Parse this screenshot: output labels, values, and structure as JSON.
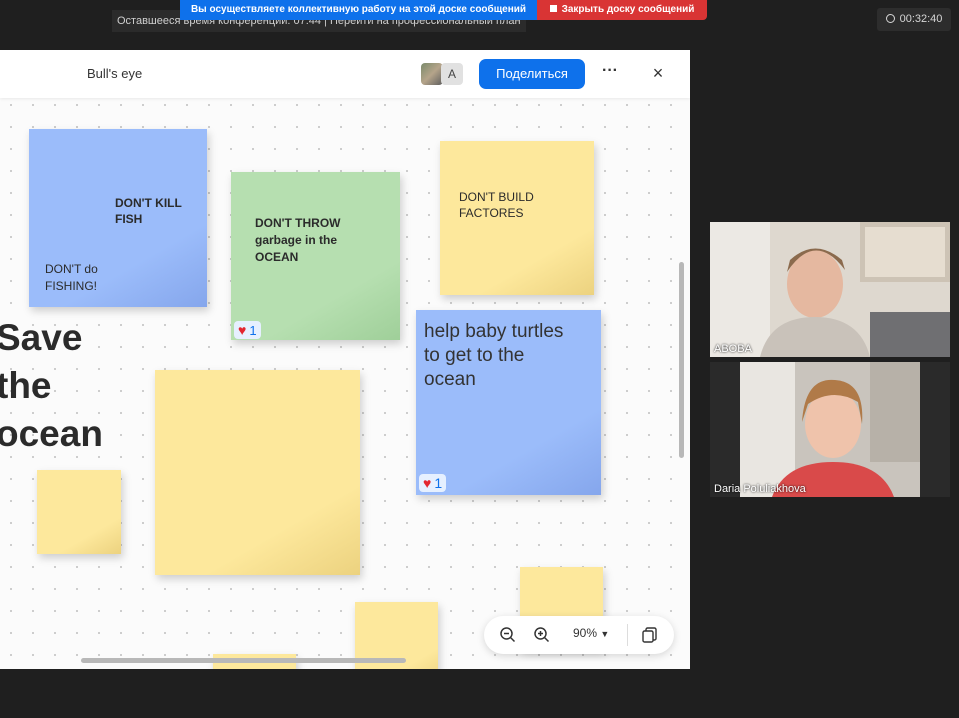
{
  "banner": {
    "conference_time": "Оставшееся время конференции: 07:44 | Перейти на профессиональный план",
    "collab_notice": "Вы осуществляете коллективную работу на этой доске сообщений",
    "close_board": "Закрыть доску сообщений"
  },
  "timer": {
    "value": "00:32:40"
  },
  "board": {
    "title": "Bull's eye",
    "avatar_letter": "A",
    "share_label": "Поделиться",
    "more_label": "···",
    "close_label": "×",
    "big_text": "Save\nthe\nocean",
    "notes": {
      "kill_fish": "DON'T KILL\nFISH",
      "fishing": "DON'T do\nFISHING!",
      "garbage": "DON'T THROW\ngarbage in the\nOCEAN",
      "factories": "DON'T BUILD\nFACTORES",
      "turtles": "help baby turtles\nto get to the\nocean"
    },
    "reactions": {
      "green_count": "1",
      "turtles_count": "1"
    },
    "zoom_level": "90%"
  },
  "participants": [
    {
      "name": "ABOBA"
    },
    {
      "name": "Daria Poluliakhova"
    }
  ],
  "colors": {
    "accent": "#0e71eb",
    "close_red": "#d93434",
    "note_blue": "#9bbcfa",
    "note_green": "#b6dfb0",
    "note_yellow": "#fde89c"
  }
}
